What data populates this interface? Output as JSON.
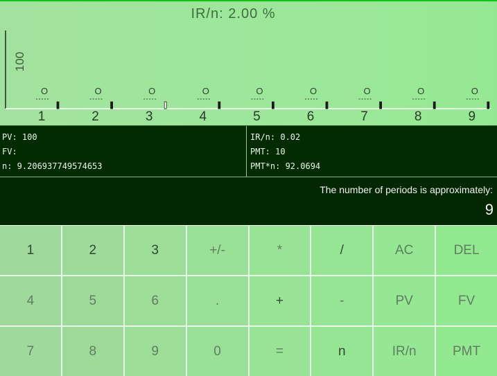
{
  "chart": {
    "title": "IR/n: 2.00 %",
    "y_axis_label": "100",
    "x_ticks": [
      "1",
      "2",
      "3",
      "4",
      "5",
      "6",
      "7",
      "8",
      "9"
    ],
    "period_symbol": "O"
  },
  "chart_data": {
    "type": "bar",
    "categories": [
      "1",
      "2",
      "3",
      "4",
      "5",
      "6",
      "7",
      "8",
      "9"
    ],
    "title": "IR/n: 2.00 %",
    "ylabel": "100",
    "values": [
      1,
      1,
      1,
      1,
      1,
      1,
      1,
      1,
      1
    ]
  },
  "info": {
    "pv": "PV: 100",
    "fv": "FV:",
    "n": "n: 9.206937749574653",
    "irn": "IR/n: 0.02",
    "pmt": "PMT: 10",
    "pmtn": "PMT*n: 92.0694"
  },
  "result": {
    "label": "The number of periods is approximately:",
    "value": "9"
  },
  "keypad": {
    "rows": [
      [
        "1",
        "2",
        "3",
        "+/-",
        "*",
        "/",
        "AC",
        "DEL"
      ],
      [
        "4",
        "5",
        "6",
        ".",
        "+",
        "-",
        "PV",
        "FV"
      ],
      [
        "7",
        "8",
        "9",
        "0",
        "=",
        "n",
        "IR/n",
        "PMT"
      ]
    ]
  },
  "colors": {
    "chart_bg": "#9ce79a",
    "panel_bg": "#022b02",
    "key_text": "#304830",
    "title_text": "#3c6e3c"
  }
}
